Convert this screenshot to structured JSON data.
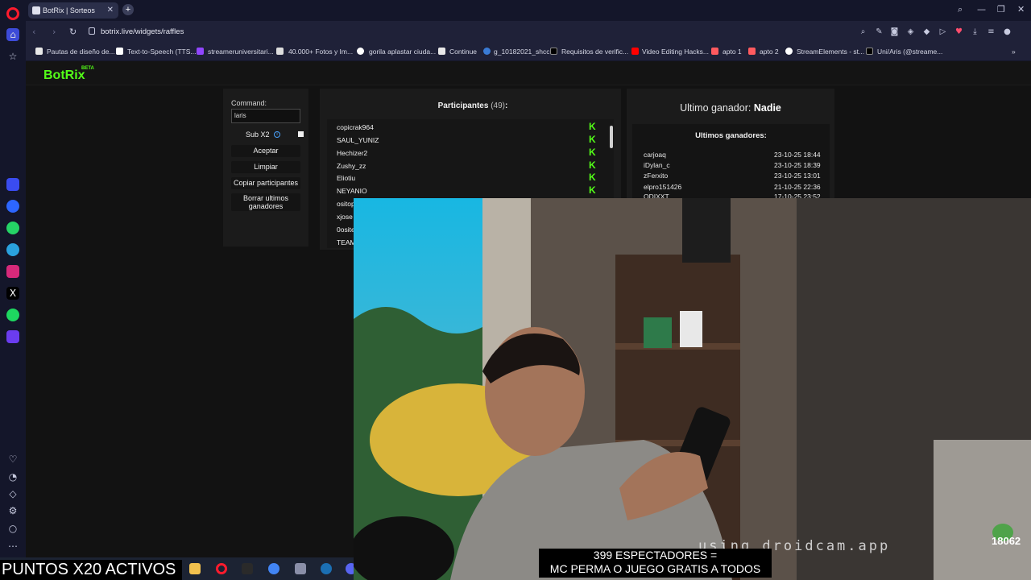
{
  "browser": {
    "tab_title": "BotRix | Sorteos",
    "url": "botrix.live/widgets/raffles",
    "bookmarks": [
      "Pautas de diseño de...",
      "Text-to-Speech (TTS...",
      "streameruniversitari...",
      "40.000+ Fotos y Im...",
      "gorila aplastar ciuda...",
      "Continue",
      "g_10182021_shcc",
      "Requisitos de verific...",
      "Video Editing Hacks...",
      "apto 1",
      "apto 2",
      "StreamElements - st...",
      "Uni/Aris (@streame..."
    ]
  },
  "app": {
    "brand": "BotRix",
    "brand_badge": "BETA"
  },
  "raffle": {
    "command_label": "Command:",
    "command_value": "laris",
    "sub_label": "Sub X2",
    "accept": "Aceptar",
    "clear": "Limpiar",
    "copy": "Copiar participantes",
    "delete_winners": "Borrar ultimos ganadores",
    "participants_label": "Participantes",
    "participants_count": "(49)",
    "participants_suffix": ":",
    "participants": [
      "copicrak964",
      "SAUL_YUNIZ",
      "Hechizer2",
      "Zushy_zz",
      "Eliotiu",
      "NEYANIO",
      "ositop",
      "xjose",
      "0osite",
      "TEAM"
    ],
    "last_winner_label": "Ultimo ganador:",
    "last_winner_value": "Nadie",
    "winners_title": "Ultimos ganadores:",
    "winners": [
      {
        "name": "carjoaq",
        "date": "23-10-25 18:44"
      },
      {
        "name": "iDylan_c",
        "date": "23-10-25 18:39"
      },
      {
        "name": "zFerxito",
        "date": "23-10-25 13:01"
      },
      {
        "name": "elpro151426",
        "date": "21-10-25 22:36"
      },
      {
        "name": "ODIXXT",
        "date": "17-10-25 23:52"
      }
    ]
  },
  "stream_overlay": {
    "watermark": "using droidcam.app",
    "badge_number": "18062",
    "points_banner": "PUNTOS X20 ACTIVOS",
    "caption_line1": "399 ESPECTADORES =",
    "caption_line2": "MC PERMA O JUEGO GRATIS A TODOS"
  },
  "colors": {
    "kick_green": "#53fc18",
    "opera_red": "#ff1b2d",
    "page_bg": "#121212"
  }
}
